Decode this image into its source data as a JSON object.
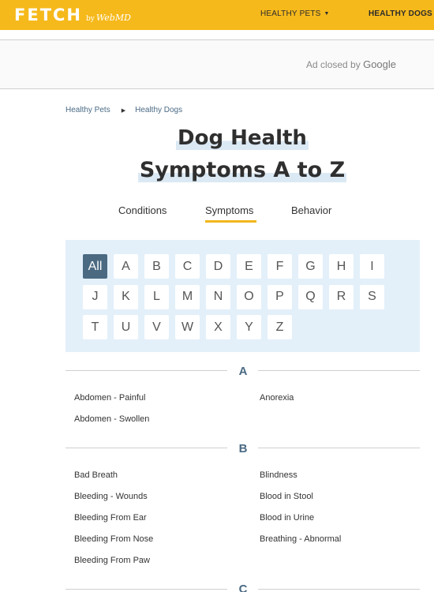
{
  "header": {
    "logo_main": "FETCH",
    "logo_by": "by",
    "logo_webmd": "WebMD",
    "nav": [
      {
        "label": "HEALTHY PETS"
      },
      {
        "label": "HEALTHY DOGS"
      }
    ]
  },
  "ad": {
    "closed_text": "Ad closed by",
    "provider": "Google"
  },
  "breadcrumb": [
    {
      "label": "Healthy Pets"
    },
    {
      "label": "Healthy Dogs"
    }
  ],
  "title": {
    "line1": "Dog Health",
    "line2": "Symptoms A to Z"
  },
  "tabs": [
    {
      "label": "Conditions"
    },
    {
      "label": "Symptoms"
    },
    {
      "label": "Behavior"
    }
  ],
  "letters": [
    "All",
    "A",
    "B",
    "C",
    "D",
    "E",
    "F",
    "G",
    "H",
    "I",
    "J",
    "K",
    "L",
    "M",
    "N",
    "O",
    "P",
    "Q",
    "R",
    "S",
    "T",
    "U",
    "V",
    "W",
    "X",
    "Y",
    "Z"
  ],
  "sections": [
    {
      "letter": "A",
      "items": [
        "Abdomen - Painful",
        "Anorexia",
        "Abdomen - Swollen"
      ]
    },
    {
      "letter": "B",
      "items": [
        "Bad Breath",
        "Blindness",
        "Bleeding - Wounds",
        "Blood in Stool",
        "Bleeding From Ear",
        "Blood in Urine",
        "Bleeding From Nose",
        "Breathing - Abnormal",
        "Bleeding From Paw"
      ]
    },
    {
      "letter": "C",
      "items": []
    }
  ],
  "colors": {
    "brand_yellow": "#f6b91b",
    "panel_blue": "#e3f0fa",
    "active_letter": "#4b6a82",
    "link_slate": "#4a6a84"
  }
}
